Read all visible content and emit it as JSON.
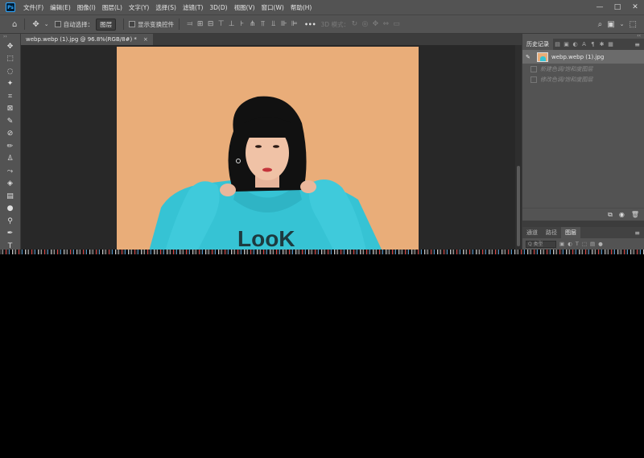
{
  "menubar": {
    "logo": "Ps",
    "items": [
      "文件(F)",
      "编辑(E)",
      "图像(I)",
      "图层(L)",
      "文字(Y)",
      "选择(S)",
      "滤镜(T)",
      "3D(D)",
      "视图(V)",
      "窗口(W)",
      "帮助(H)"
    ],
    "window_controls": {
      "minimize": "—",
      "maximize": "□",
      "close": "✕"
    }
  },
  "options_bar": {
    "auto_select_label": "自动选择：",
    "auto_select_value": "图层",
    "show_transform_label": "显示变换控件",
    "more": "•••",
    "mode_3d_label": "3D 模式："
  },
  "document": {
    "tab_title": "webp.webp (1).jpg @ 96.8%(RGB/8#) *",
    "close": "×"
  },
  "canvas": {
    "shirt_text": "LooK",
    "background_color": "#e9ad79",
    "hoodie_color": "#36c3d4",
    "hair_color": "#111111"
  },
  "history_panel": {
    "tabs": [
      "历史记录"
    ],
    "snapshot_name": "webp.webp (1).jpg",
    "items": [
      "新建色调/饱和度图层",
      "修改色调/饱和度图层"
    ]
  },
  "layers_panel": {
    "tabs": [
      "通道",
      "路径",
      "图层"
    ],
    "filter_placeholder": "Q 类型"
  }
}
